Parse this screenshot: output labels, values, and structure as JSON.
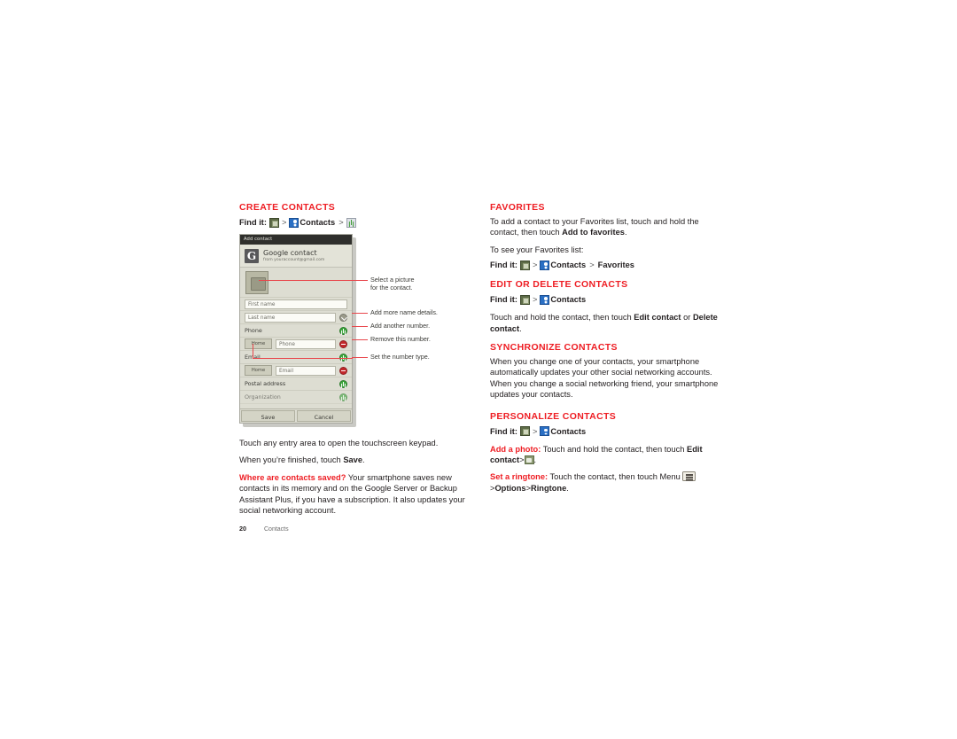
{
  "doc": {
    "page_number": "20",
    "chapter": "Contacts",
    "accent_color": "#ee1d23"
  },
  "left_column": {
    "create_contacts": {
      "heading": "CREATE CONTACTS",
      "findit": {
        "label": "Find it:",
        "icon1": "apps-icon",
        "sep1": ">",
        "icon2": "contacts-icon",
        "word": "Contacts",
        "sep2": ">",
        "icon3": "plus-icon"
      }
    },
    "paragraphs": {
      "p1": "Touch any entry area to open the touchscreen keypad.",
      "p2_pre": "When you’re finished, touch ",
      "p2_bold": "Save",
      "p2_post": ".",
      "p3_lead": "Where are contacts saved?",
      "p3_rest": " Your smartphone saves new contacts in its memory and on the Google Server or Backup Assistant Plus, if you have a subscription. It also updates your social networking account."
    }
  },
  "phone": {
    "titlebar": "Add contact",
    "account": {
      "logo": "G",
      "name": "Google contact",
      "email": "from youraccount@gmail.com"
    },
    "photo_placeholder": "contact-photo-icon",
    "fields": {
      "first_name": "First name",
      "last_name": "Last name",
      "phone_section": "Phone",
      "phone_type": "Home",
      "phone_input": "Phone",
      "email_section": "Email",
      "email_type": "Home",
      "email_input": "Email",
      "postal_address": "Postal address",
      "organization": "Organization"
    },
    "buttons": {
      "save": "Save",
      "cancel": "Cancel"
    }
  },
  "callouts": {
    "c1_line1": "Select a picture",
    "c1_line2": "for the contact.",
    "c2": "Add more name details.",
    "c3": "Add another number.",
    "c4": "Remove this number.",
    "c5": "Set the number type."
  },
  "right_column": {
    "favorites": {
      "heading": "FAVORITES",
      "p1_pre": "To add a contact to your Favorites list, touch and hold the contact, then touch ",
      "p1_bold": "Add to favorites",
      "p1_post": ".",
      "p2": "To see your Favorites list:",
      "findit": {
        "label": "Find it:",
        "icon1": "apps-icon",
        "sep1": ">",
        "icon2": "contacts-icon",
        "word": "Contacts",
        "sep2": ">",
        "word2": "Favorites"
      }
    },
    "edit_delete": {
      "heading": "EDIT OR DELETE CONTACTS",
      "findit": {
        "label": "Find it:",
        "icon1": "apps-icon",
        "sep1": ">",
        "icon2": "contacts-icon",
        "word": "Contacts"
      },
      "p1_pre": "Touch and hold the contact, then touch ",
      "p1_bold1": "Edit contact",
      "p1_mid": " or ",
      "p1_bold2": "Delete contact",
      "p1_post": "."
    },
    "synchronize": {
      "heading": "SYNCHRONIZE CONTACTS",
      "p1": "When you change one of your contacts, your smartphone automatically updates your other social networking accounts. When you change a social networking friend, your smartphone updates your contacts."
    },
    "personalize": {
      "heading": "PERSONALIZE CONTACTS",
      "findit": {
        "label": "Find it:",
        "icon1": "apps-icon",
        "sep1": ">",
        "icon2": "contacts-icon",
        "word": "Contacts"
      },
      "photo_lead": "Add a photo:",
      "photo_rest": " Touch and hold the contact, then touch ",
      "photo_bold": "Edit contact",
      "photo_sep": ">",
      "photo_icon": "photo-icon",
      "photo_end": ".",
      "ringtone_lead": "Set a ringtone:",
      "ringtone_rest": " Touch the contact, then touch Menu ",
      "ringtone_icon": "menu-icon",
      "ringtone_sep1": ">",
      "ringtone_bold1": "Options",
      "ringtone_sep2": ">",
      "ringtone_bold2": "Ringtone",
      "ringtone_end": "."
    }
  }
}
